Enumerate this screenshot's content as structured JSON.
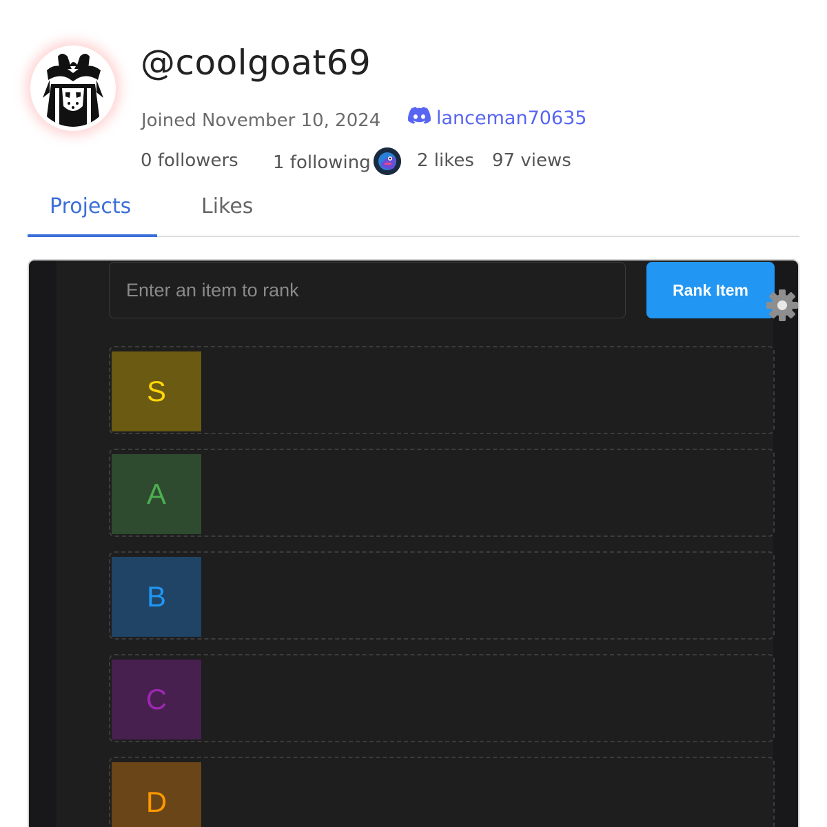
{
  "profile": {
    "username": "@coolgoat69",
    "joined": "Joined November 10, 2024",
    "discord": "lanceman70635",
    "stats": {
      "followers": "0 followers",
      "following": "1 following",
      "likes": "2 likes",
      "views": "97 views"
    }
  },
  "tabs": [
    {
      "label": "Projects",
      "active": true
    },
    {
      "label": "Likes",
      "active": false
    }
  ],
  "app": {
    "input_placeholder": "Enter an item to rank",
    "button_label": "Rank Item",
    "tiers": [
      {
        "label": "S",
        "bg": "#6b5a12",
        "fg": "#ffd60a"
      },
      {
        "label": "A",
        "bg": "#2e4b2f",
        "fg": "#4caf50"
      },
      {
        "label": "B",
        "bg": "#1f4466",
        "fg": "#2196f3"
      },
      {
        "label": "C",
        "bg": "#47204f",
        "fg": "#9c27b0"
      },
      {
        "label": "D",
        "bg": "#6a4517",
        "fg": "#ff9800"
      }
    ]
  },
  "colors": {
    "accent": "#3b6fd8",
    "discord": "#5865f2",
    "button": "#2196f3"
  }
}
